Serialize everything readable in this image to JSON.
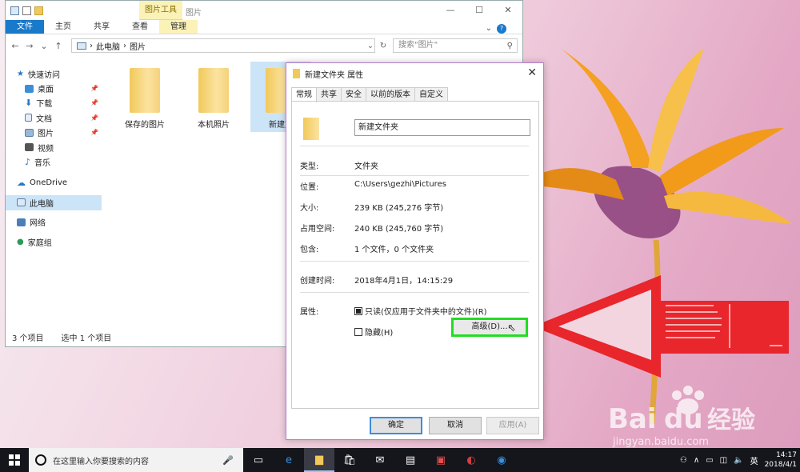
{
  "explorer": {
    "tool_tab": "图片工具",
    "title": "图片",
    "window_controls": {
      "minimize": "—",
      "maximize": "☐",
      "close": "✕"
    },
    "ribbon_tabs": [
      "文件",
      "主页",
      "共享",
      "查看",
      "管理"
    ],
    "ribbon_extra": {
      "expand": "⌄",
      "help": "?"
    },
    "nav": {
      "back": "←",
      "forward": "→",
      "recent": "⌄",
      "up": "↑"
    },
    "address": {
      "part1": "此电脑",
      "sep": "›",
      "part2": "图片",
      "dropdown": "⌄",
      "refresh": "↻"
    },
    "search_placeholder": "搜索\"图片\"",
    "search_icon": "⚲",
    "sidebar": {
      "quick_access": "快速访问",
      "desktop": "桌面",
      "downloads": "下载",
      "documents": "文档",
      "pictures": "图片",
      "videos": "视频",
      "music": "音乐",
      "onedrive": "OneDrive",
      "this_pc": "此电脑",
      "network": "网络",
      "homegroup": "家庭组",
      "pin": "📌"
    },
    "folders": [
      "保存的图片",
      "本机照片",
      "新建文"
    ],
    "status": {
      "items": "3 个项目",
      "selected": "选中 1 个项目"
    }
  },
  "dialog": {
    "title": "新建文件夹 属性",
    "close": "✕",
    "tabs": [
      "常规",
      "共享",
      "安全",
      "以前的版本",
      "自定义"
    ],
    "name_value": "新建文件夹",
    "props": {
      "type_label": "类型:",
      "type_value": "文件夹",
      "location_label": "位置:",
      "location_value": "C:\\Users\\gezhi\\Pictures",
      "size_label": "大小:",
      "size_value": "239 KB (245,276 字节)",
      "disk_label": "占用空间:",
      "disk_value": "240 KB (245,760 字节)",
      "contains_label": "包含:",
      "contains_value": "1 个文件，0 个文件夹",
      "created_label": "创建时间:",
      "created_value": "2018年4月1日，14:15:29",
      "attr_label": "属性:"
    },
    "readonly_label": "只读(仅应用于文件夹中的文件)(R)",
    "readonly_checked": true,
    "hidden_label": "隐藏(H)",
    "hidden_checked": false,
    "advanced_button": "高级(D)...",
    "ok": "确定",
    "cancel": "取消",
    "apply": "应用(A)"
  },
  "taskbar": {
    "search_text": "在这里输入你要搜索的内容",
    "apps": [
      "task-view-icon",
      "edge-icon",
      "file-explorer-icon",
      "store-icon",
      "mail-icon",
      "news-icon",
      "onenote-icon",
      "paint-icon",
      "app-icon"
    ],
    "tray": {
      "ime": "英",
      "time": "14:17",
      "date": "2018/4/1"
    }
  },
  "colors": {
    "highlight": "#22dd22",
    "arrow": "#e8262b",
    "accent": "#1979ca"
  }
}
